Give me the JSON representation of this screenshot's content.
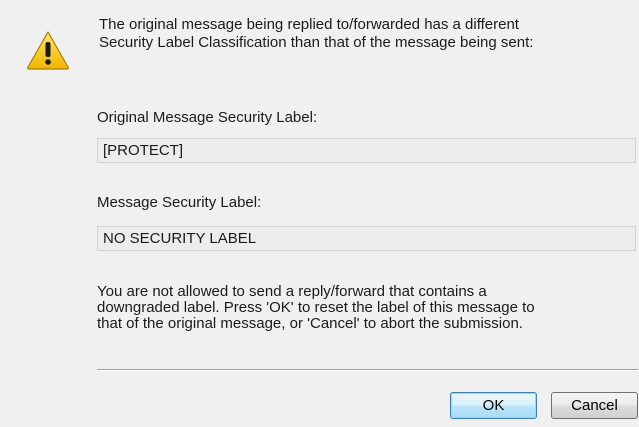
{
  "dialog": {
    "header_message_line1": "The original message being replied to/forwarded has a different",
    "header_message_line2": "Security Label Classification than that of the message being sent:",
    "original_label_caption": "Original Message Security Label:",
    "original_label_value": "[PROTECT]",
    "message_label_caption": "Message Security Label:",
    "message_label_value": "NO SECURITY LABEL",
    "body_message_line1": "You are not allowed to send a reply/forward that contains a",
    "body_message_line2": "downgraded label. Press 'OK' to reset the label of this message to",
    "body_message_line3": "that of the original message, or 'Cancel' to abort the submission.",
    "icon": "warning-icon"
  },
  "buttons": {
    "ok_label": "OK",
    "cancel_label": "Cancel"
  },
  "colors": {
    "background": "#f0f0f0",
    "warning_yellow": "#f5c400",
    "default_button_border": "#3c7fb1"
  }
}
